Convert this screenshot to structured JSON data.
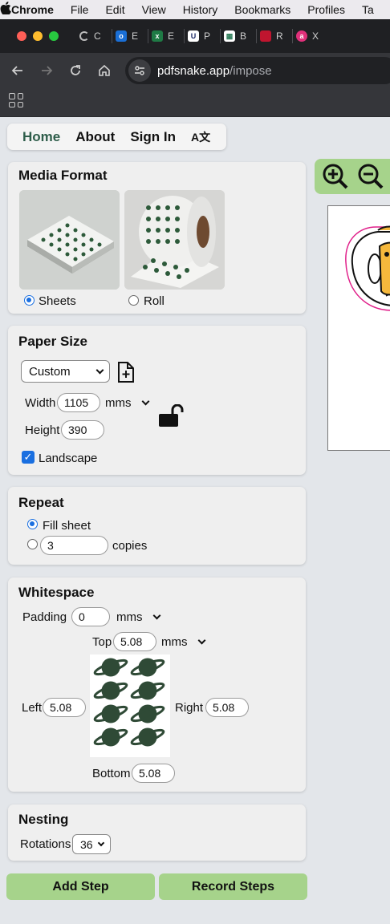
{
  "menubar": {
    "apple": "",
    "items": [
      "Chrome",
      "File",
      "Edit",
      "View",
      "History",
      "Bookmarks",
      "Profiles",
      "Ta"
    ]
  },
  "tabs": [
    {
      "title": "C",
      "icon": "loading-icon",
      "color": "#3a3a3a"
    },
    {
      "title": "E",
      "icon": "outlook-icon",
      "color": "#1a6fd6"
    },
    {
      "title": "E",
      "icon": "excel-icon",
      "color": "#1f7a45"
    },
    {
      "title": "P",
      "icon": "u-icon",
      "color": "#1d2a66"
    },
    {
      "title": "B",
      "icon": "bank-icon",
      "color": "#2e7d5a"
    },
    {
      "title": "R",
      "icon": "red-square-icon",
      "color": "#c0152f"
    },
    {
      "title": "X",
      "icon": "pink-circle-icon",
      "color": "#e0307a"
    }
  ],
  "address": {
    "domain": "pdfsnake.app",
    "path": "/impose"
  },
  "nav": {
    "home": "Home",
    "about": "About",
    "signin": "Sign In",
    "lang": "A文"
  },
  "media": {
    "title": "Media Format",
    "sheets_label": "Sheets",
    "roll_label": "Roll",
    "selected": "Sheets"
  },
  "paper": {
    "title": "Paper Size",
    "preset": "Custom",
    "width_label": "Width",
    "width_value": "1105",
    "unit": "mms",
    "height_label": "Height",
    "height_value": "390",
    "landscape_label": "Landscape",
    "landscape_checked": true
  },
  "repeat": {
    "title": "Repeat",
    "fill_label": "Fill sheet",
    "copies_value": "3",
    "copies_label": "copies",
    "selected": "Fill sheet"
  },
  "whitespace": {
    "title": "Whitespace",
    "padding_label": "Padding",
    "padding_value": "0",
    "padding_unit": "mms",
    "top_label": "Top",
    "top_value": "5.08",
    "margin_unit": "mms",
    "left_label": "Left",
    "left_value": "5.08",
    "right_label": "Right",
    "right_value": "5.08",
    "bottom_label": "Bottom",
    "bottom_value": "5.08"
  },
  "nesting": {
    "title": "Nesting",
    "rotations_label": "Rotations",
    "rotations_value": "36"
  },
  "buttons": {
    "add_step": "Add Step",
    "record_steps": "Record Steps"
  },
  "colors": {
    "accent_green": "#a6d38b",
    "nav_home": "#2e5d4a",
    "planet": "#2f4a36",
    "checkbox": "#1a6fe0"
  }
}
